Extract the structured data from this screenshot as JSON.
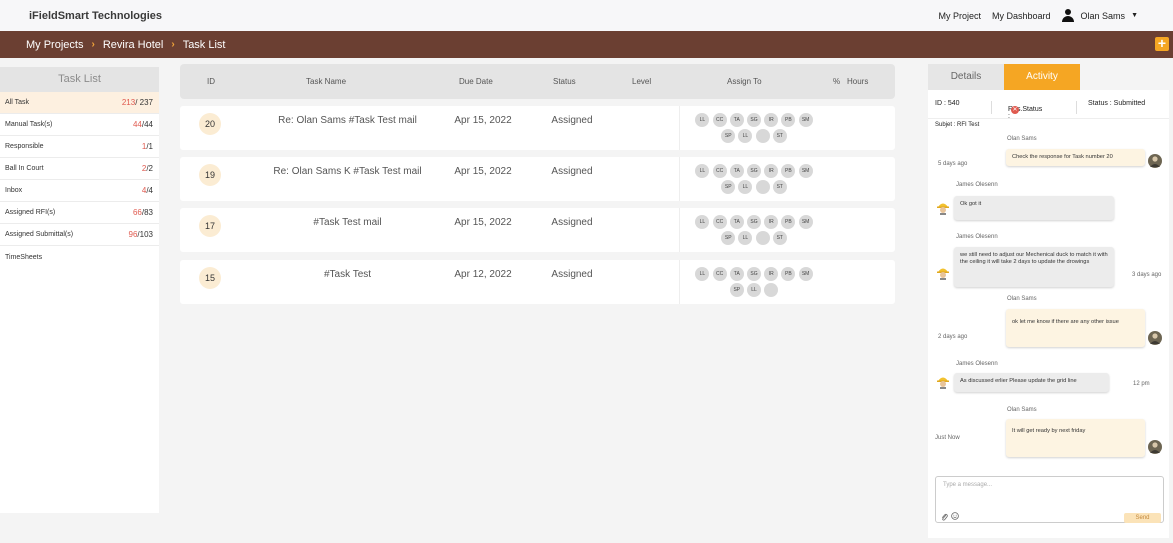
{
  "app": {
    "brand": "iFieldSmart Technologies"
  },
  "topnav": {
    "my_project": "My Project",
    "my_dashboard": "My Dashboard",
    "user_name": "Olan Sams",
    "caret": "▼"
  },
  "breadcrumb": {
    "items": [
      "My Projects",
      "Revira Hotel",
      "Task List"
    ],
    "sep": "›",
    "add_label": "+"
  },
  "sidebar": {
    "title": "Task List",
    "items": [
      {
        "label": "All Task",
        "red": "213",
        "rest": "/ 237"
      },
      {
        "label": "Manual Task(s)",
        "red": "44",
        "rest": "/44"
      },
      {
        "label": "Responsible",
        "red": "1",
        "rest": "/1"
      },
      {
        "label": "Ball In Court",
        "red": "2",
        "rest": "/2"
      },
      {
        "label": "Inbox",
        "red": "4",
        "rest": "/4"
      },
      {
        "label": "Assigned RFI(s)",
        "red": "66",
        "rest": "/83"
      },
      {
        "label": "Assigned Submittal(s)",
        "red": "96",
        "rest": "/103"
      },
      {
        "label": "TimeSheets",
        "red": "",
        "rest": ""
      }
    ]
  },
  "table": {
    "headers": {
      "id": "ID",
      "task_name": "Task Name",
      "due_date": "Due Date",
      "status": "Status",
      "level": "Level",
      "assign_to": "Assign To",
      "pct": "%",
      "hours": "Hours"
    },
    "rows": [
      {
        "id": "20",
        "name": "Re: Olan Sams #Task Test mail",
        "due": "Apr 15, 2022",
        "status": "Assigned",
        "avatars": [
          "LL",
          "CC",
          "TA",
          "SG",
          "IR",
          "PB",
          "SM",
          "SP",
          "LL",
          "",
          "ST"
        ]
      },
      {
        "id": "19",
        "name": "Re: Olan Sams K #Task Test mail",
        "due": "Apr 15, 2022",
        "status": "Assigned",
        "avatars": [
          "LL",
          "CC",
          "TA",
          "SG",
          "IR",
          "PB",
          "SM",
          "SP",
          "LL",
          "",
          "ST"
        ]
      },
      {
        "id": "17",
        "name": "#Task Test mail",
        "due": "Apr 15, 2022",
        "status": "Assigned",
        "avatars": [
          "LL",
          "CC",
          "TA",
          "SG",
          "IR",
          "PB",
          "SM",
          "SP",
          "LL",
          "",
          "ST"
        ]
      },
      {
        "id": "15",
        "name": "#Task Test",
        "due": "Apr 12, 2022",
        "status": "Assigned",
        "avatars": [
          "LL",
          "CC",
          "TA",
          "SG",
          "IR",
          "PB",
          "SM",
          "SP",
          "LL",
          ""
        ]
      }
    ]
  },
  "detail": {
    "tabs": {
      "details": "Details",
      "activity": "Activity"
    },
    "id_text": "ID : 540",
    "res_status": "Res.Status :",
    "status_text": "Status : Submitted",
    "subject": "Subjet : RFI Test",
    "messages": [
      {
        "sender": "Olan Sams",
        "text": "Check the response for Task number 20",
        "time": "5 days ago"
      },
      {
        "sender": "James Olesenn",
        "text": "Ok got it",
        "time": ""
      },
      {
        "sender": "James Olesenn",
        "text": "we still need to adjust our Mechenical duck to match it with the ceiling it will take 2 days to update the drowings",
        "time": "3 days ago"
      },
      {
        "sender": "Olan Sams",
        "text": "ok let me know if there are any other issue",
        "time": "2 days ago"
      },
      {
        "sender": "James Olesenn",
        "text": "As discussed erlier Please update the grid line",
        "time": "12 pm"
      },
      {
        "sender": "Olan Sams",
        "text": "It will get ready by next friday",
        "time": "Just Now"
      }
    ],
    "composer": {
      "placeholder": "Type a message...",
      "send": "Send"
    }
  },
  "colors": {
    "brand_bar": "#6b3f32",
    "accent": "#f5a623",
    "count_red": "#e05a4f"
  }
}
